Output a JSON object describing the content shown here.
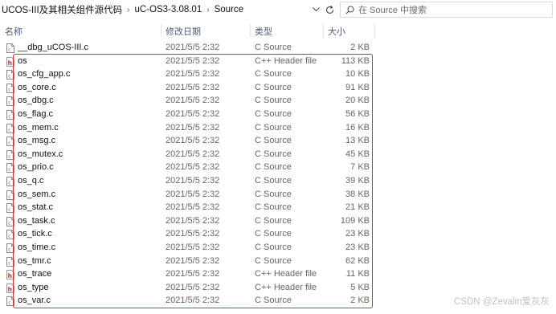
{
  "breadcrumbs": [
    "UCOS-III及其相关组件源代码",
    "uC-OS3-3.08.01",
    "Source"
  ],
  "search": {
    "placeholder": "在 Source 中搜索"
  },
  "columns": {
    "name": "名称",
    "date": "修改日期",
    "type": "类型",
    "size": "大小"
  },
  "files": [
    {
      "name": "__dbg_uCOS-III.c",
      "date": "2021/5/5 2:32",
      "type": "C Source",
      "size": "2 KB",
      "icon": "c-file"
    },
    {
      "name": "os",
      "date": "2021/5/5 2:32",
      "type": "C++ Header file",
      "size": "113 KB",
      "icon": "h-file"
    },
    {
      "name": "os_cfg_app.c",
      "date": "2021/5/5 2:32",
      "type": "C Source",
      "size": "10 KB",
      "icon": "c-file"
    },
    {
      "name": "os_core.c",
      "date": "2021/5/5 2:32",
      "type": "C Source",
      "size": "91 KB",
      "icon": "c-file"
    },
    {
      "name": "os_dbg.c",
      "date": "2021/5/5 2:32",
      "type": "C Source",
      "size": "20 KB",
      "icon": "c-file"
    },
    {
      "name": "os_flag.c",
      "date": "2021/5/5 2:32",
      "type": "C Source",
      "size": "56 KB",
      "icon": "c-file"
    },
    {
      "name": "os_mem.c",
      "date": "2021/5/5 2:32",
      "type": "C Source",
      "size": "16 KB",
      "icon": "c-file"
    },
    {
      "name": "os_msg.c",
      "date": "2021/5/5 2:32",
      "type": "C Source",
      "size": "13 KB",
      "icon": "c-file"
    },
    {
      "name": "os_mutex.c",
      "date": "2021/5/5 2:32",
      "type": "C Source",
      "size": "45 KB",
      "icon": "c-file"
    },
    {
      "name": "os_prio.c",
      "date": "2021/5/5 2:32",
      "type": "C Source",
      "size": "7 KB",
      "icon": "c-file"
    },
    {
      "name": "os_q.c",
      "date": "2021/5/5 2:32",
      "type": "C Source",
      "size": "39 KB",
      "icon": "c-file"
    },
    {
      "name": "os_sem.c",
      "date": "2021/5/5 2:32",
      "type": "C Source",
      "size": "38 KB",
      "icon": "c-file"
    },
    {
      "name": "os_stat.c",
      "date": "2021/5/5 2:32",
      "type": "C Source",
      "size": "21 KB",
      "icon": "c-file"
    },
    {
      "name": "os_task.c",
      "date": "2021/5/5 2:32",
      "type": "C Source",
      "size": "109 KB",
      "icon": "c-file"
    },
    {
      "name": "os_tick.c",
      "date": "2021/5/5 2:32",
      "type": "C Source",
      "size": "23 KB",
      "icon": "c-file"
    },
    {
      "name": "os_time.c",
      "date": "2021/5/5 2:32",
      "type": "C Source",
      "size": "23 KB",
      "icon": "c-file"
    },
    {
      "name": "os_tmr.c",
      "date": "2021/5/5 2:32",
      "type": "C Source",
      "size": "62 KB",
      "icon": "c-file"
    },
    {
      "name": "os_trace",
      "date": "2021/5/5 2:32",
      "type": "C++ Header file",
      "size": "11 KB",
      "icon": "h-file"
    },
    {
      "name": "os_type",
      "date": "2021/5/5 2:32",
      "type": "C++ Header file",
      "size": "5 KB",
      "icon": "h-file"
    },
    {
      "name": "os_var.c",
      "date": "2021/5/5 2:32",
      "type": "C Source",
      "size": "2 KB",
      "icon": "c-file"
    }
  ],
  "watermark": "CSDN @Zevalin爱灰灰",
  "colors": {
    "highlight_border": "#e0302b",
    "header_icon_red": "#c8322a"
  }
}
